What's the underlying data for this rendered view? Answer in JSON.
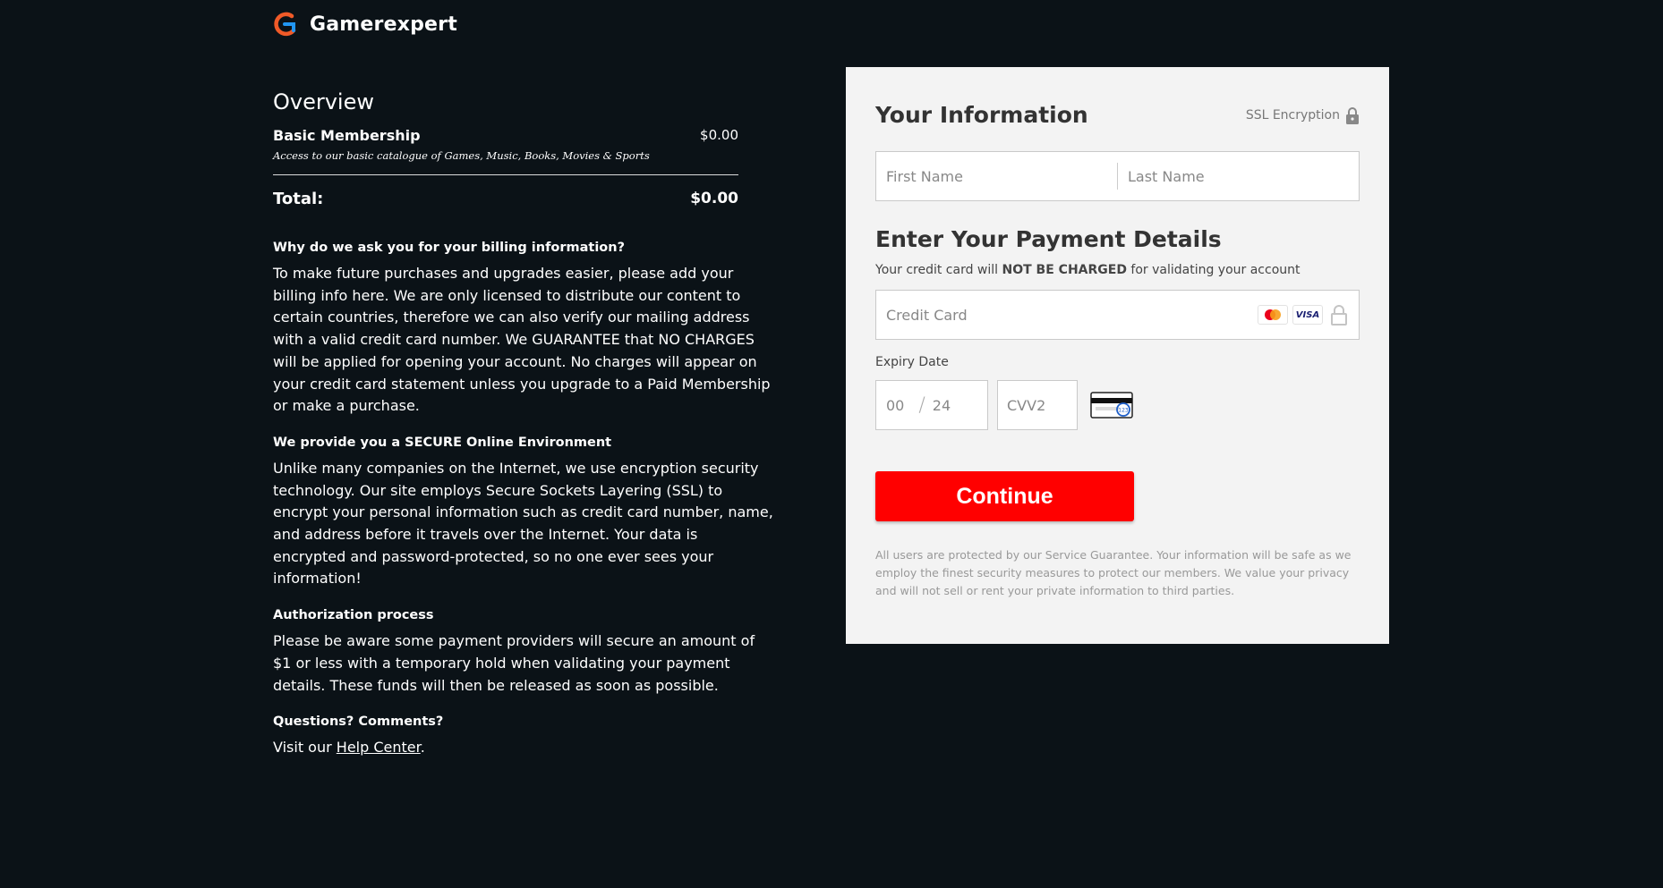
{
  "brand": {
    "name": "Gamerexpert",
    "logo_icon": "gamerexpert-logo-icon",
    "logo_colors": [
      "#f05a28",
      "#2196f3"
    ]
  },
  "overview": {
    "title": "Overview",
    "item": {
      "name": "Basic Membership",
      "price": "$0.00",
      "description": "Access to our basic catalogue of Games, Music, Books, Movies & Sports"
    },
    "total_label": "Total:",
    "total_value": "$0.00"
  },
  "info": [
    {
      "heading": "Why do we ask you for your billing information?",
      "text": "To make future purchases and upgrades easier, please add your billing info here. We are only licensed to distribute our content to certain countries, therefore we can also verify our mailing address with a valid credit card number. We GUARANTEE that NO CHARGES will be applied for opening your account. No charges will appear on your credit card statement unless you upgrade to a Paid Membership or make a purchase."
    },
    {
      "heading": "We provide you a SECURE Online Environment",
      "text": "Unlike many companies on the Internet, we use encryption security technology. Our site employs Secure Sockets Layering (SSL) to encrypt your personal information such as credit card number, name, and address before it travels over the Internet. Your data is encrypted and password-protected, so no one ever sees your information!"
    },
    {
      "heading": "Authorization process",
      "text": "Please be aware some payment providers will secure an amount of $1 or less with a temporary hold when validating your payment details. These funds will then be released as soon as possible."
    },
    {
      "heading": "Questions? Comments?",
      "text_prefix": "Visit our ",
      "link": "Help Center",
      "text_suffix": "."
    }
  ],
  "form": {
    "title": "Your Information",
    "ssl_label": "SSL Encryption",
    "first_name_placeholder": "First Name",
    "last_name_placeholder": "Last Name",
    "payment_title": "Enter Your Payment Details",
    "payment_note_prefix": "Your credit card will ",
    "payment_note_bold": "NOT BE CHARGED",
    "payment_note_suffix": " for validating your account",
    "credit_card_placeholder": "Credit Card",
    "card_icons": [
      "mastercard-icon",
      "visa-icon",
      "lock-icon"
    ],
    "visa_label": "VISA",
    "expiry_label": "Expiry Date",
    "expiry_month": "00",
    "expiry_year": "24",
    "cvv_placeholder": "CVV2",
    "continue_label": "Continue",
    "continue_color": "#ff0000",
    "guarantee": "All users are protected by our Service Guarantee. Your information will be safe as we employ the finest security measures to protect our members. We value your privacy and will not sell or rent your private information to third parties."
  }
}
